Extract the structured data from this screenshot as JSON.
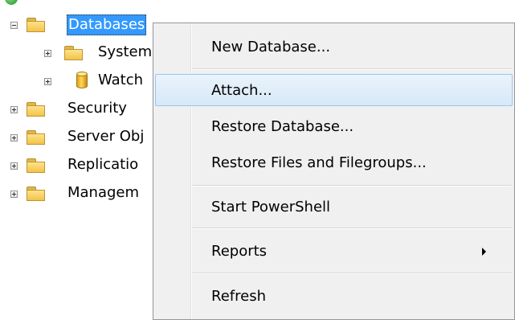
{
  "tree": {
    "databases": "Databases",
    "system": "System",
    "watch": "Watch",
    "security": "Security",
    "server_objects": "Server Obj",
    "replication": "Replicatio",
    "management": "Managem"
  },
  "context_menu": {
    "items": [
      {
        "label": "New Database..."
      },
      {
        "label": "Attach..."
      },
      {
        "label": "Restore Database..."
      },
      {
        "label": "Restore Files and Filegroups..."
      },
      {
        "label": "Start PowerShell"
      },
      {
        "label": "Reports"
      },
      {
        "label": "Refresh"
      }
    ]
  },
  "colors": {
    "selection": "#3399ff",
    "menu_background": "#f0f0f0",
    "menu_highlight_border": "#99c6ef",
    "folder": "#f3c34a"
  }
}
